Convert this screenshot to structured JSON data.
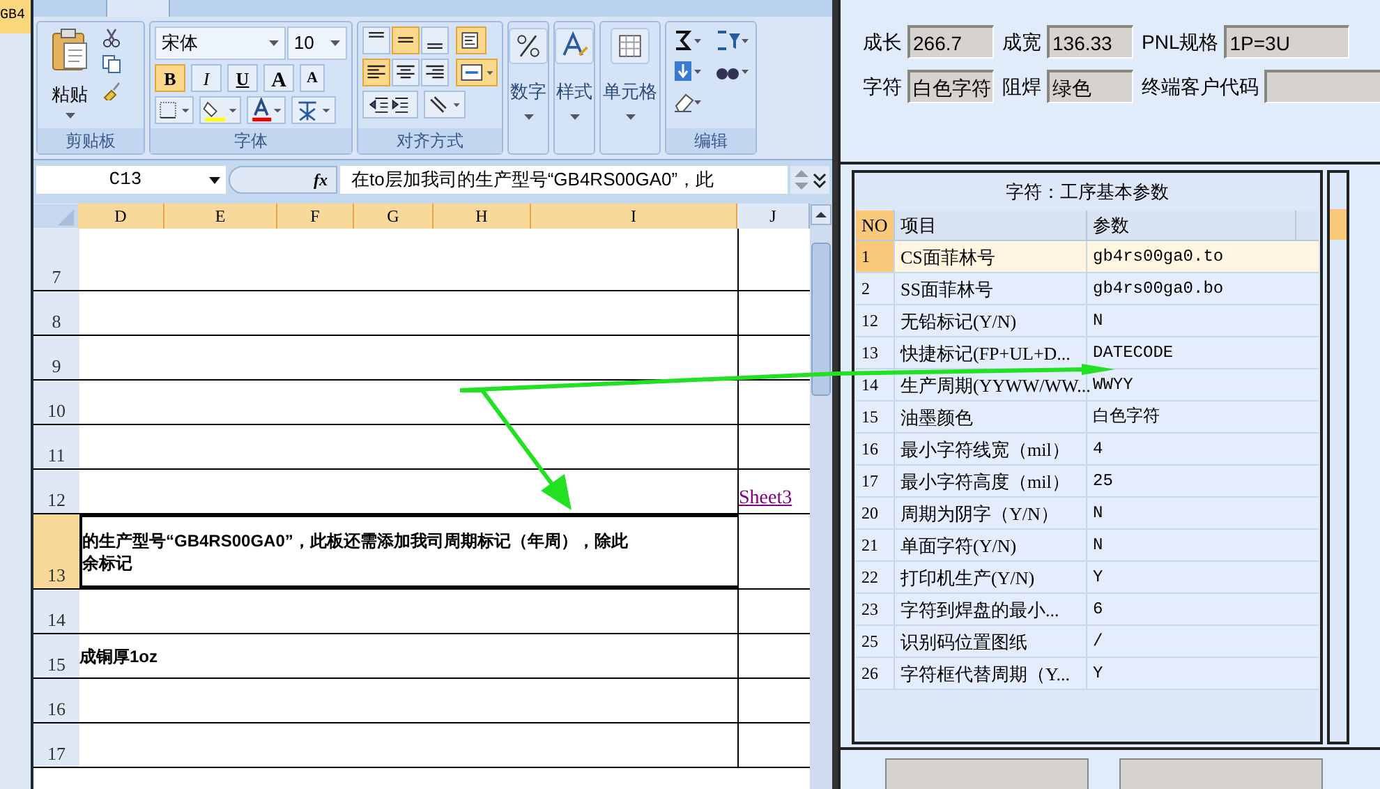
{
  "corner_cell": "GB4",
  "ribbon": {
    "clipboard": {
      "label": "剪贴板",
      "paste": "粘贴"
    },
    "font": {
      "label": "字体",
      "name": "宋体",
      "size": "10",
      "buttons": [
        {
          "kind": "bold",
          "label": "B",
          "selected": true
        },
        {
          "kind": "italic",
          "label": "I",
          "selected": false
        },
        {
          "kind": "underline",
          "label": "U",
          "selected": false
        }
      ],
      "grow": "A",
      "shrink": "A"
    },
    "alignment": {
      "label": "对齐方式",
      "vertical": [
        {
          "selected": false
        },
        {
          "selected": true
        },
        {
          "selected": false
        }
      ],
      "horizontal": [
        {
          "selected": true
        },
        {
          "selected": false
        },
        {
          "selected": false
        }
      ],
      "wrap": {
        "selected": true
      },
      "merge": {
        "selected": true
      }
    },
    "number": "数字",
    "styles": "样式",
    "cells": "单元格",
    "editing": "编辑"
  },
  "formula_bar": {
    "cell": "C13",
    "fx": "fx",
    "formula": "在to层加我司的生产型号“GB4RS00GA0”，此"
  },
  "sheet": {
    "columns": [
      {
        "label": "D",
        "selected": true
      },
      {
        "label": "E",
        "selected": true
      },
      {
        "label": "F",
        "selected": true
      },
      {
        "label": "G",
        "selected": true
      },
      {
        "label": "H",
        "selected": true
      },
      {
        "label": "I",
        "selected": true
      },
      {
        "label": "J",
        "selected": false
      }
    ],
    "rows": [
      {
        "label": "7",
        "selected": false
      },
      {
        "label": "8",
        "selected": false
      },
      {
        "label": "9",
        "selected": false
      },
      {
        "label": "10",
        "selected": false
      },
      {
        "label": "11",
        "selected": false
      },
      {
        "label": "12",
        "selected": false,
        "link": "Sheet3"
      },
      {
        "label": "13",
        "selected": true,
        "lines": [
          "的生产型号“GB4RS00GA0”，此板还需添加我司周期标记（年周），除此",
          "余标记"
        ]
      },
      {
        "label": "14",
        "selected": false
      },
      {
        "label": "15",
        "selected": false,
        "lines": [
          "成铜厚1oz"
        ]
      },
      {
        "label": "16",
        "selected": false
      },
      {
        "label": "17",
        "selected": false
      }
    ]
  },
  "info_fields": [
    [
      {
        "label": "成长",
        "value": "266.7"
      },
      {
        "label": "成宽",
        "value": "136.33"
      },
      {
        "label": "PNL规格",
        "value": "1P=3U"
      }
    ],
    [
      {
        "label": "字符",
        "value": "白色字符"
      },
      {
        "label": "阻焊",
        "value": "绿色"
      },
      {
        "label": "终端客户代码"
      }
    ]
  ],
  "table": {
    "title": "字符：工序基本参数",
    "columns": [
      "NO",
      "项目",
      "参数"
    ],
    "rows": [
      {
        "no": "1",
        "item": "CS面菲林号",
        "value": "gb4rs00ga0.to",
        "selected": true
      },
      {
        "no": "2",
        "item": "SS面菲林号",
        "value": "gb4rs00ga0.bo",
        "selected": false
      },
      {
        "no": "12",
        "item": "无铅标记(Y/N)",
        "value": "N",
        "selected": false
      },
      {
        "no": "13",
        "item": "快捷标记(FP+UL+D...",
        "value": "DATECODE",
        "selected": false
      },
      {
        "no": "14",
        "item": "生产周期(YYWW/WW...",
        "value": "WWYY",
        "selected": false
      },
      {
        "no": "15",
        "item": "油墨颜色",
        "value": "白色字符",
        "selected": false
      },
      {
        "no": "16",
        "item": "最小字符线宽（mil）",
        "value": "4",
        "selected": false
      },
      {
        "no": "17",
        "item": "最小字符高度（mil）",
        "value": "25",
        "selected": false
      },
      {
        "no": "20",
        "item": "周期为阴字（Y/N）",
        "value": "N",
        "selected": false
      },
      {
        "no": "21",
        "item": "单面字符(Y/N)",
        "value": "N",
        "selected": false
      },
      {
        "no": "22",
        "item": "打印机生产(Y/N)",
        "value": "Y",
        "selected": false
      },
      {
        "no": "23",
        "item": "字符到焊盘的最小...",
        "value": "6",
        "selected": false
      },
      {
        "no": "25",
        "item": "识别码位置图纸",
        "value": "/",
        "selected": false
      },
      {
        "no": "26",
        "item": "字符框代替周期（Y...",
        "value": "Y",
        "selected": false
      }
    ]
  }
}
